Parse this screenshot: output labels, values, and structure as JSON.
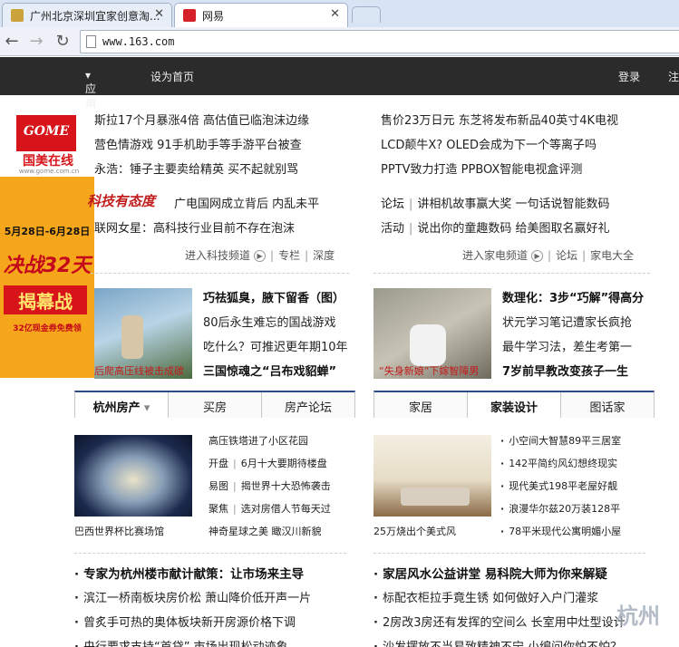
{
  "browser": {
    "tabs": [
      {
        "title": "广州北京深圳宜家创意淘..."
      },
      {
        "title": "网易"
      }
    ],
    "address": "www.163.com"
  },
  "topbar": {
    "apps": "应用",
    "set_home": "设为首页",
    "login": "登录",
    "register": "注"
  },
  "ad": {
    "brand": "国美在线",
    "url": "www.gome.com.cn",
    "dates": "5月28日-6月28日",
    "battle": "决战32天",
    "unveil": "揭幕战",
    "promo": "32亿现金券免费领"
  },
  "tech": {
    "headlines": [
      "斯拉17个月暴涨4倍  高估值已临泡沫边缘",
      "营色情游戏  91手机助手等手游平台被查",
      "永浩：锤子主要卖给精英  买不起就别骂"
    ],
    "attitude_logo": "科技有态度",
    "attitude_items": [
      "广电国网成立背后  内乱未平",
      "联网女星：高科技行业目前不存在泡沫"
    ],
    "links": [
      "进入科技频道",
      "专栏",
      "深度"
    ]
  },
  "home_appliance": {
    "headlines": [
      "售价23万日元  东芝将发布新品40英寸4K电视",
      "LCD颠牛X? OLED会成为下一个等离子吗",
      "PPTV致力打造  PPBOX智能电视盒评测"
    ],
    "forum_items": [
      [
        "论坛",
        "讲相机故事赢大奖  一句话说智能数码"
      ],
      [
        "活动",
        "说出你的童趣数码  给美图取名赢好礼"
      ]
    ],
    "links": [
      "进入家电频道",
      "论坛",
      "家电大全"
    ]
  },
  "feature_left": {
    "caption": "后爬高压线被击成碳",
    "items": [
      "巧祛狐臭，腋下留香（图）",
      "80后永生难忘的国战游戏",
      "吃什么？可推迟更年期10年",
      "三国惊魂之“吕布戏貂蝉”"
    ]
  },
  "feature_right": {
    "caption": "“失身新娘”下嫁智障男",
    "items": [
      "数理化：3步“巧解”得高分",
      "状元学习笔记遭家长疯抢",
      "最牛学习法，差生考第一",
      "7岁前早教改变孩子一生"
    ]
  },
  "house": {
    "tabs": [
      "杭州房产",
      "买房",
      "房产论坛"
    ],
    "caption": "巴西世界杯比赛场馆",
    "news": [
      [
        "",
        "高压铁塔进了小区花园"
      ],
      [
        "开盘",
        "6月十大要期待楼盘"
      ],
      [
        "易图",
        "揭世界十大恐怖袭击"
      ],
      [
        "聚焦",
        "选对房借人节每天过"
      ],
      [
        "",
        "神奇星球之美  瞰汉川新貌"
      ]
    ],
    "headline": "专家为杭州楼市献计献策：让市场来主导",
    "items": [
      "滨江一桥南板块房价松  萧山降价低开声一片",
      "曾炙手可热的奥体板块新开房源价格下调",
      "央行要求支持“首贷” 市场出现松动迹象"
    ]
  },
  "decor": {
    "tabs": [
      "家居",
      "家装设计",
      "图话家"
    ],
    "caption": "25万烧出个美式风",
    "news": [
      "小空间大智慧89平三居室",
      "142平简约风幻想终现实",
      "现代美式198平老屋好靓",
      "浪漫华尔兹20万装128平",
      "78平米现代公寓明媚小屋"
    ],
    "headline": "家居风水公益讲堂  易科院大师为你来解疑",
    "items": [
      "标配衣柜拉手竟生锈  如何做好入户门灌浆",
      "2房改3房还有发挥的空间么  长室用中灶型设计",
      "沙发摆放不当易致精神不宁  小编问你怕不怕？"
    ]
  },
  "watermark": "杭州"
}
